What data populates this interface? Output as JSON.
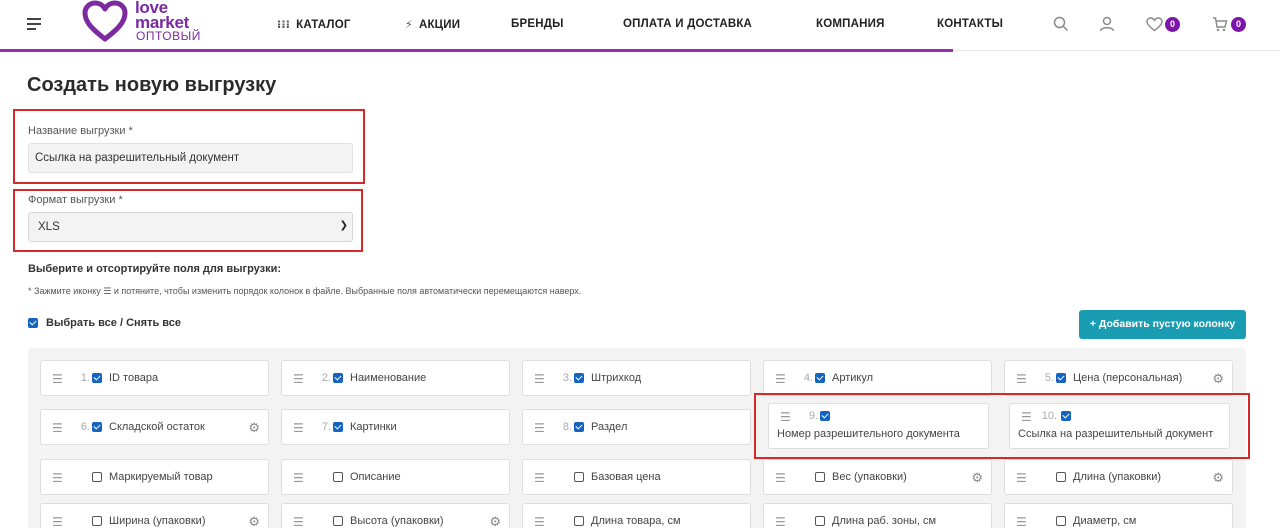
{
  "brand": {
    "logo_line1": "love",
    "logo_line2": "market",
    "logo_sub": "ОПТОВЫЙ",
    "accent": "#7b2aa0"
  },
  "nav": [
    {
      "label": "КАТАЛОГ",
      "icon": "grid-icon"
    },
    {
      "label": "АКЦИИ",
      "icon": "lightning-icon"
    },
    {
      "label": "БРЕНДЫ"
    },
    {
      "label": "ОПЛАТА И ДОСТАВКА"
    },
    {
      "label": "КОМПАНИЯ"
    },
    {
      "label": "КОНТАКТЫ"
    }
  ],
  "header_icons": {
    "wishlist_count": "0",
    "cart_count": "0"
  },
  "page": {
    "title": "Создать новую выгрузку",
    "name_label": "Название выгрузки *",
    "name_value": "Ссылка на разрешительный документ",
    "format_label": "Формат выгрузки *",
    "format_value": "XLS",
    "section_title": "Выберите и отсортируйте поля для выгрузки:",
    "hint": "* Зажмите иконку ☰ и потяните, чтобы изменить порядок колонок в файле. Выбранные поля автоматически перемещаются наверх.",
    "select_all": "Выбрать все / Снять все",
    "add_column": "+ Добавить пустую колонку"
  },
  "fields": [
    {
      "num": "1.",
      "label": "ID товара",
      "checked": true,
      "gear": false
    },
    {
      "num": "2.",
      "label": "Наименование",
      "checked": true,
      "gear": false
    },
    {
      "num": "3.",
      "label": "Штрихкод",
      "checked": true,
      "gear": false
    },
    {
      "num": "4.",
      "label": "Артикул",
      "checked": true,
      "gear": false
    },
    {
      "num": "5.",
      "label": "Цена (персональная)",
      "checked": true,
      "gear": true
    },
    {
      "num": "6.",
      "label": "Складской остаток",
      "checked": true,
      "gear": true
    },
    {
      "num": "7.",
      "label": "Картинки",
      "checked": true,
      "gear": false
    },
    {
      "num": "8.",
      "label": "Раздел",
      "checked": true,
      "gear": false
    },
    {
      "num": "9.",
      "label": "Номер разрешительного документа",
      "checked": true,
      "gear": false
    },
    {
      "num": "10.",
      "label": "Ссылка на разрешительный документ",
      "checked": true,
      "gear": false
    },
    {
      "num": "",
      "label": "Маркируемый товар",
      "checked": false,
      "gear": false
    },
    {
      "num": "",
      "label": "Описание",
      "checked": false,
      "gear": false
    },
    {
      "num": "",
      "label": "Базовая цена",
      "checked": false,
      "gear": false
    },
    {
      "num": "",
      "label": "Вес (упаковки)",
      "checked": false,
      "gear": true
    },
    {
      "num": "",
      "label": "Длина (упаковки)",
      "checked": false,
      "gear": true
    },
    {
      "num": "",
      "label": "Ширина (упаковки)",
      "checked": false,
      "gear": true
    },
    {
      "num": "",
      "label": "Высота (упаковки)",
      "checked": false,
      "gear": true
    },
    {
      "num": "",
      "label": "Длина товара, см",
      "checked": false,
      "gear": false
    },
    {
      "num": "",
      "label": "Длина раб. зоны, см",
      "checked": false,
      "gear": false
    },
    {
      "num": "",
      "label": "Диаметр, см",
      "checked": false,
      "gear": false
    }
  ]
}
